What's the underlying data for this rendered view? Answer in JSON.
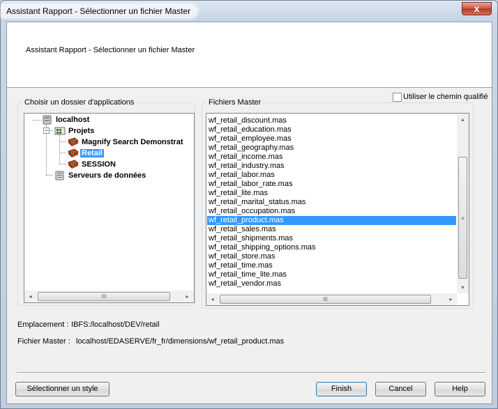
{
  "window": {
    "title": "Assistant Rapport - Sélectionner un fichier Master",
    "close_glyph": "x"
  },
  "header": {
    "title": "Assistant Rapport - Sélectionner un fichier Master"
  },
  "folders": {
    "label": "Choisir un dossier d'applications",
    "tree": [
      {
        "label": "localhost",
        "icon": "server-icon"
      },
      {
        "label": "Projets",
        "icon": "projects-icon"
      },
      {
        "label": "Magnify Search Demonstrat",
        "icon": "app-folder-icon"
      },
      {
        "label": "Retail",
        "icon": "app-folder-icon",
        "selected": true
      },
      {
        "label": "SESSION",
        "icon": "app-folder-icon"
      },
      {
        "label": "Serveurs de données",
        "icon": "database-servers-icon"
      }
    ],
    "scroll_left": "◂",
    "scroll_right": "▸",
    "thumb_grip": "III"
  },
  "master_files": {
    "label": "Fichiers Master",
    "use_qualified_path_label": "Utiliser le chemin qualifié",
    "use_qualified_path_checked": false,
    "files": [
      "wf_retail_discount.mas",
      "wf_retail_education.mas",
      "wf_retail_employee.mas",
      "wf_retail_geography.mas",
      "wf_retail_income.mas",
      "wf_retail_industry.mas",
      "wf_retail_labor.mas",
      "wf_retail_labor_rate.mas",
      "wf_retail_lite.mas",
      "wf_retail_marital_status.mas",
      "wf_retail_occupation.mas",
      "wf_retail_product.mas",
      "wf_retail_sales.mas",
      "wf_retail_shipments.mas",
      "wf_retail_shipping_options.mas",
      "wf_retail_store.mas",
      "wf_retail_time.mas",
      "wf_retail_time_lite.mas",
      "wf_retail_vendor.mas"
    ],
    "selected_index": 11,
    "scroll_up": "▴",
    "scroll_down": "▾",
    "scroll_left": "◂",
    "scroll_right": "▸",
    "thumb_grip": "III",
    "vthumb_grip": "≡"
  },
  "info": {
    "location_label": "Emplacement :",
    "location_value": "IBFS:/localhost/DEV/retail",
    "master_label": "Fichier Master :",
    "master_value": "localhost/EDASERVE/fr_fr/dimensions/wf_retail_product.mas"
  },
  "buttons": {
    "select_style": "Sélectionner un style",
    "finish": "Finish",
    "cancel": "Cancel",
    "help": "Help"
  }
}
